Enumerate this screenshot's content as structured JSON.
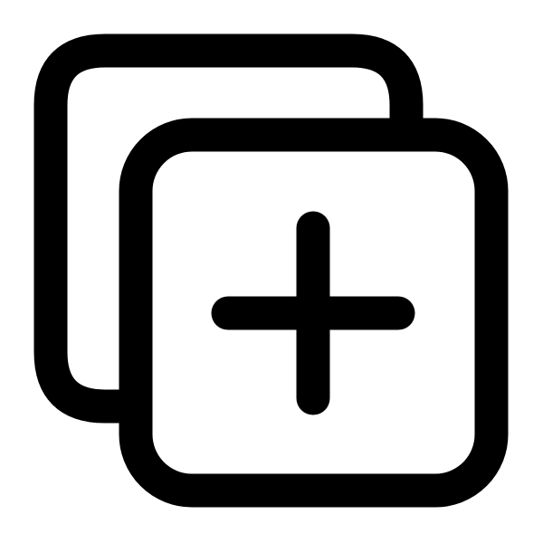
{
  "icon": {
    "name": "duplicate-add-icon",
    "stroke_color": "#000000",
    "background_color": "#ffffff"
  }
}
